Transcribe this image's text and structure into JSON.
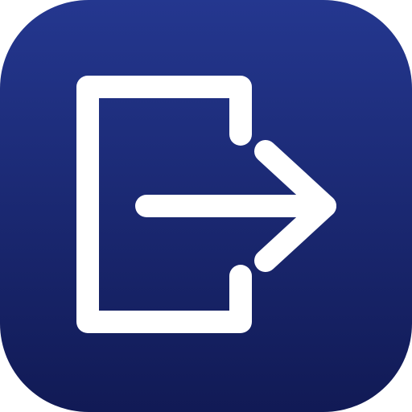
{
  "icon": {
    "name": "logout-icon",
    "colors": {
      "background_top": "#24378F",
      "background_bottom": "#111A55",
      "glyph": "#FFFFFF"
    }
  }
}
